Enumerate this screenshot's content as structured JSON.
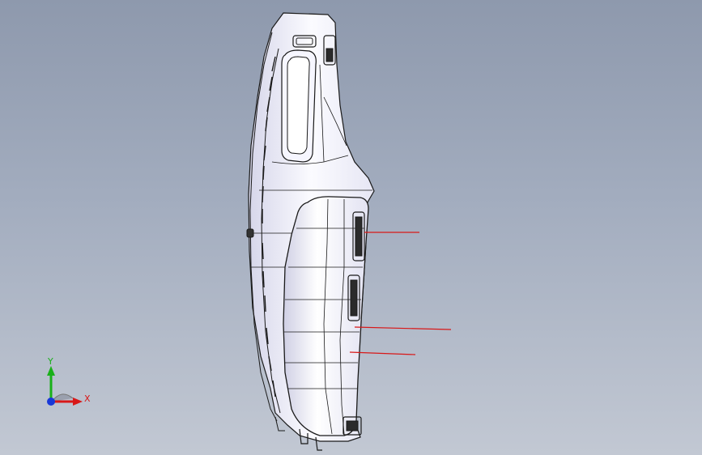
{
  "viewport": {
    "background_top": "#8e99ad",
    "background_bottom": "#c2c8d3",
    "edge_color": "#1a1a1a",
    "face_color": "#f2f2fb",
    "shadow_color": "#c9c9dd",
    "callout_color": "#d81818"
  },
  "model": {
    "name": "dashboard-instrument-panel"
  },
  "triad": {
    "y_label": "Y",
    "x_label": "X",
    "y_color": "#19b019",
    "x_color": "#d81818",
    "z_color": "#1838d8"
  }
}
